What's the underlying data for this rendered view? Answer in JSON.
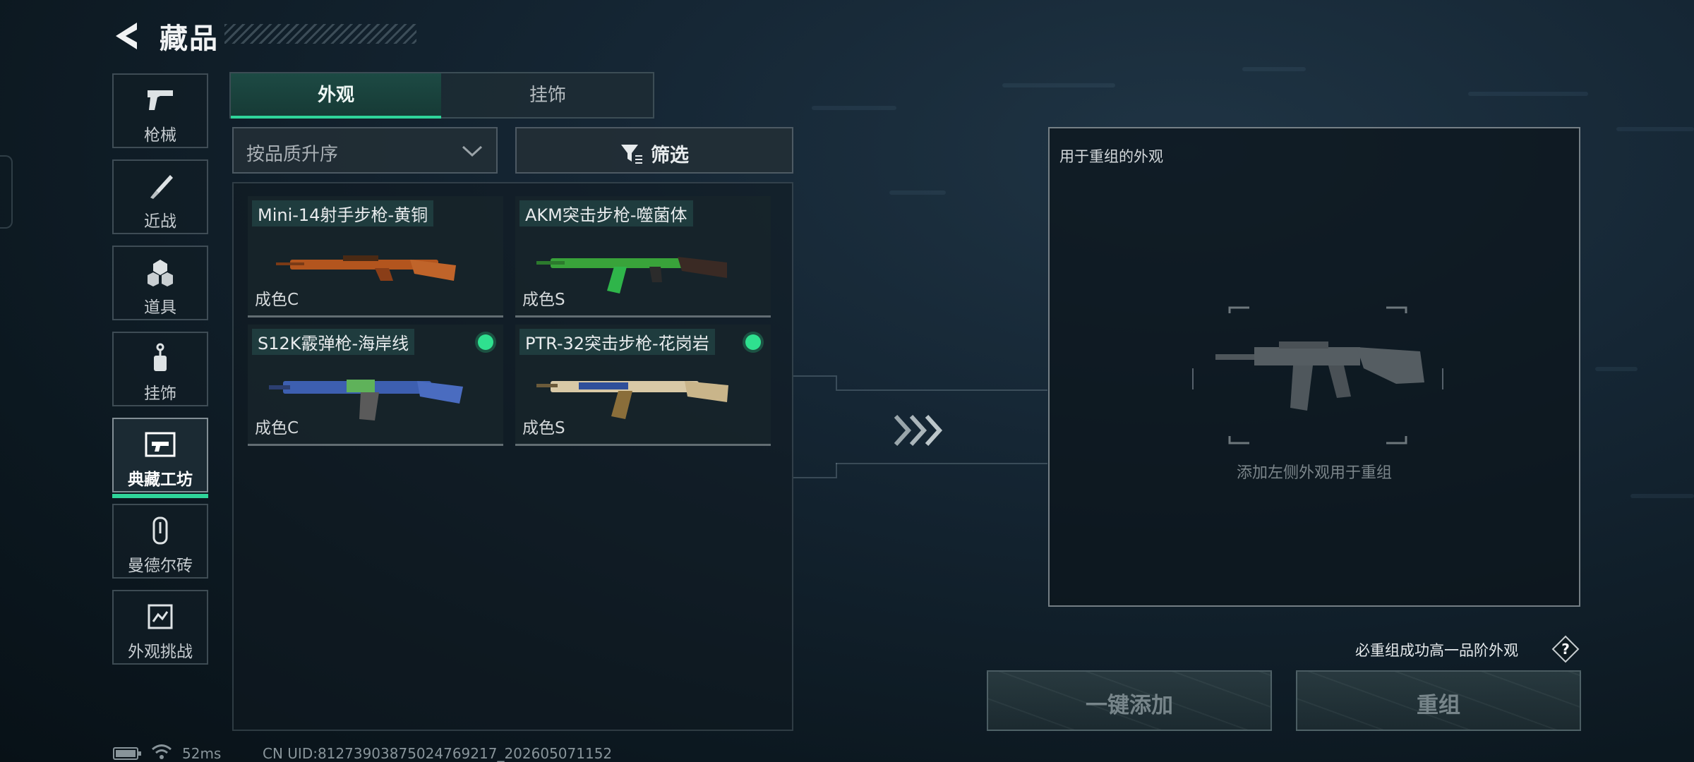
{
  "header": {
    "title": "藏品"
  },
  "sidebar": {
    "items": [
      {
        "label": "枪械",
        "icon": "pistol-icon"
      },
      {
        "label": "近战",
        "icon": "knife-icon"
      },
      {
        "label": "道具",
        "icon": "grenade-icon"
      },
      {
        "label": "挂饰",
        "icon": "charm-icon"
      },
      {
        "label": "典藏工坊",
        "icon": "workshop-icon",
        "active": true
      },
      {
        "label": "曼德尔砖",
        "icon": "mandel-brick-icon"
      },
      {
        "label": "外观挑战",
        "icon": "challenge-icon"
      }
    ]
  },
  "tabs": [
    {
      "label": "外观",
      "active": true
    },
    {
      "label": "挂饰",
      "active": false
    }
  ],
  "sort": {
    "label": "按品质升序"
  },
  "filter": {
    "label": "筛选"
  },
  "items": [
    {
      "name": "Mini-14射手步枪-黄铜",
      "grade": "成色C",
      "marked": false
    },
    {
      "name": "AKM突击步枪-噬菌体",
      "grade": "成色S",
      "marked": false
    },
    {
      "name": "S12K霰弹枪-海岸线",
      "grade": "成色C",
      "marked": true
    },
    {
      "name": "PTR-32突击步枪-花岗岩",
      "grade": "成色S",
      "marked": true
    }
  ],
  "target": {
    "title": "用于重组的外观",
    "hint": "添加左侧外观用于重组"
  },
  "guarantee": {
    "text": "必重组成功高一品阶外观",
    "help_icon": "?"
  },
  "buttons": {
    "one_click_add": "一键添加",
    "reforge": "重组"
  },
  "status": {
    "ping": "52ms",
    "uid": "CN UID:81273903875024769217_202605071152"
  },
  "colors": {
    "accent": "#2fd49a",
    "marker": "#2fe08f"
  }
}
